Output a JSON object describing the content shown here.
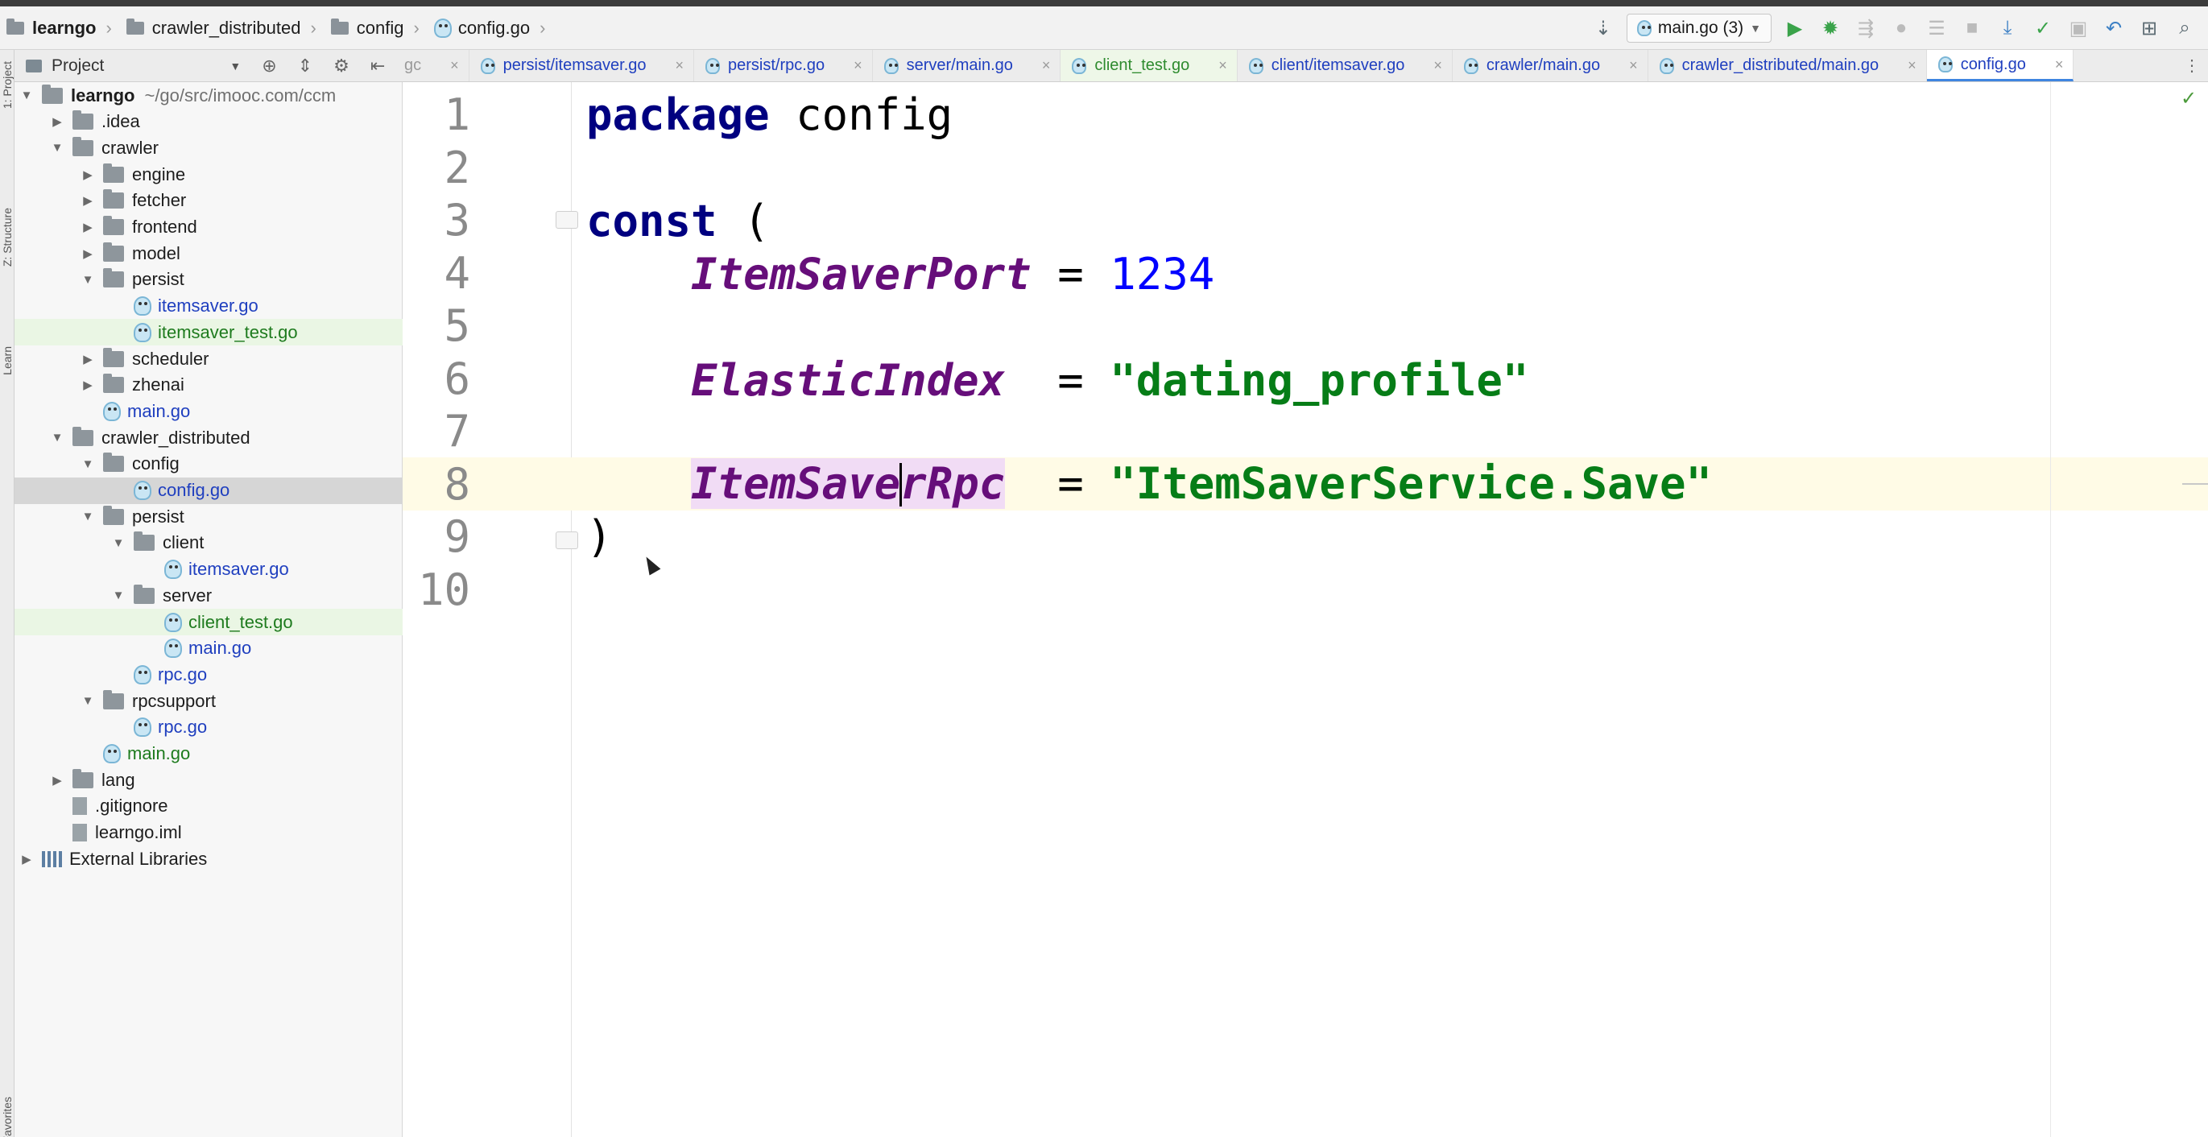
{
  "breadcrumb": {
    "items": [
      {
        "label": "learngo",
        "icon": "project-folder-icon"
      },
      {
        "label": "crawler_distributed",
        "icon": "folder-icon"
      },
      {
        "label": "config",
        "icon": "folder-icon"
      },
      {
        "label": "config.go",
        "icon": "go-file-icon"
      }
    ]
  },
  "toolbar": {
    "run_config_label": "main.go (3)",
    "icons": [
      "build-icon",
      "run-icon",
      "debug-icon",
      "coverage-icon",
      "profile-icon",
      "stop-icon",
      "vcs-update-icon",
      "vcs-commit-icon",
      "vcs-history-icon",
      "revert-icon",
      "project-structure-icon",
      "search-icon"
    ]
  },
  "side_stripe": {
    "project_label": "1: Project",
    "structure_label": "Z: Structure",
    "learn_label": "Learn",
    "favorites_label": "Favorites"
  },
  "project_panel": {
    "title": "Project",
    "tree": [
      {
        "label": "learngo",
        "path": "~/go/src/imooc.com/ccm",
        "type": "project",
        "expanded": true,
        "depth": 0
      },
      {
        "label": ".idea",
        "type": "folder",
        "expanded": false,
        "depth": 1
      },
      {
        "label": "crawler",
        "type": "folder",
        "expanded": true,
        "depth": 1
      },
      {
        "label": "engine",
        "type": "folder",
        "expanded": false,
        "depth": 2
      },
      {
        "label": "fetcher",
        "type": "folder",
        "expanded": false,
        "depth": 2
      },
      {
        "label": "frontend",
        "type": "folder",
        "expanded": false,
        "depth": 2
      },
      {
        "label": "model",
        "type": "folder",
        "expanded": false,
        "depth": 2
      },
      {
        "label": "persist",
        "type": "folder",
        "expanded": true,
        "depth": 2
      },
      {
        "label": "itemsaver.go",
        "type": "go",
        "depth": 3
      },
      {
        "label": "itemsaver_test.go",
        "type": "go-test",
        "depth": 3
      },
      {
        "label": "scheduler",
        "type": "folder",
        "expanded": false,
        "depth": 2
      },
      {
        "label": "zhenai",
        "type": "folder",
        "expanded": false,
        "depth": 2
      },
      {
        "label": "main.go",
        "type": "go",
        "depth": 2
      },
      {
        "label": "crawler_distributed",
        "type": "folder",
        "expanded": true,
        "depth": 1
      },
      {
        "label": "config",
        "type": "folder",
        "expanded": true,
        "depth": 2
      },
      {
        "label": "config.go",
        "type": "go",
        "depth": 3,
        "selected": true
      },
      {
        "label": "persist",
        "type": "folder",
        "expanded": true,
        "depth": 2
      },
      {
        "label": "client",
        "type": "folder",
        "expanded": true,
        "depth": 3
      },
      {
        "label": "itemsaver.go",
        "type": "go",
        "depth": 4
      },
      {
        "label": "server",
        "type": "folder",
        "expanded": true,
        "depth": 3
      },
      {
        "label": "client_test.go",
        "type": "go-test",
        "depth": 4
      },
      {
        "label": "main.go",
        "type": "go",
        "depth": 4
      },
      {
        "label": "rpc.go",
        "type": "go",
        "depth": 3
      },
      {
        "label": "rpcsupport",
        "type": "folder",
        "expanded": true,
        "depth": 2
      },
      {
        "label": "rpc.go",
        "type": "go",
        "depth": 3
      },
      {
        "label": "main.go",
        "type": "go-green",
        "depth": 2
      },
      {
        "label": "lang",
        "type": "folder",
        "expanded": false,
        "depth": 1
      },
      {
        "label": ".gitignore",
        "type": "file",
        "depth": 1
      },
      {
        "label": "learngo.iml",
        "type": "file",
        "depth": 1
      },
      {
        "label": "External Libraries",
        "type": "library",
        "expanded": false,
        "depth": 0
      }
    ]
  },
  "tabs": [
    {
      "label": "gc",
      "state": "clipped"
    },
    {
      "label": "persist/itemsaver.go",
      "state": "normal"
    },
    {
      "label": "persist/rpc.go",
      "state": "normal"
    },
    {
      "label": "server/main.go",
      "state": "normal"
    },
    {
      "label": "client_test.go",
      "state": "green"
    },
    {
      "label": "client/itemsaver.go",
      "state": "normal"
    },
    {
      "label": "crawler/main.go",
      "state": "normal"
    },
    {
      "label": "crawler_distributed/main.go",
      "state": "normal"
    },
    {
      "label": "config.go",
      "state": "active"
    }
  ],
  "tabs_overflow_label": "⋮",
  "editor": {
    "current_line": 8,
    "lines": [
      {
        "no": "1"
      },
      {
        "no": "2"
      },
      {
        "no": "3"
      },
      {
        "no": "4"
      },
      {
        "no": "5"
      },
      {
        "no": "6"
      },
      {
        "no": "7"
      },
      {
        "no": "8"
      },
      {
        "no": "9"
      },
      {
        "no": "10"
      }
    ],
    "code": {
      "l1_kw": "package",
      "l1_name": "config",
      "l3_kw": "const",
      "l3_paren": "(",
      "l4_name": "ItemSaverPort",
      "l4_eq": " = ",
      "l4_val": "1234",
      "l6_name": "ElasticIndex",
      "l6_eq": " = ",
      "l6_val": "\"dating_profile\"",
      "l8_name_a": "ItemSave",
      "l8_name_b": "rRpc",
      "l8_eq": " = ",
      "l8_val": "\"ItemSaverService.Save\"",
      "l9_paren": ")"
    }
  },
  "colors": {
    "keyword": "#000080",
    "constant": "#660e7a",
    "number": "#0000ff",
    "string": "#067d17",
    "current_line": "#fffbe6",
    "selection_tree": "#d6d6d6"
  }
}
